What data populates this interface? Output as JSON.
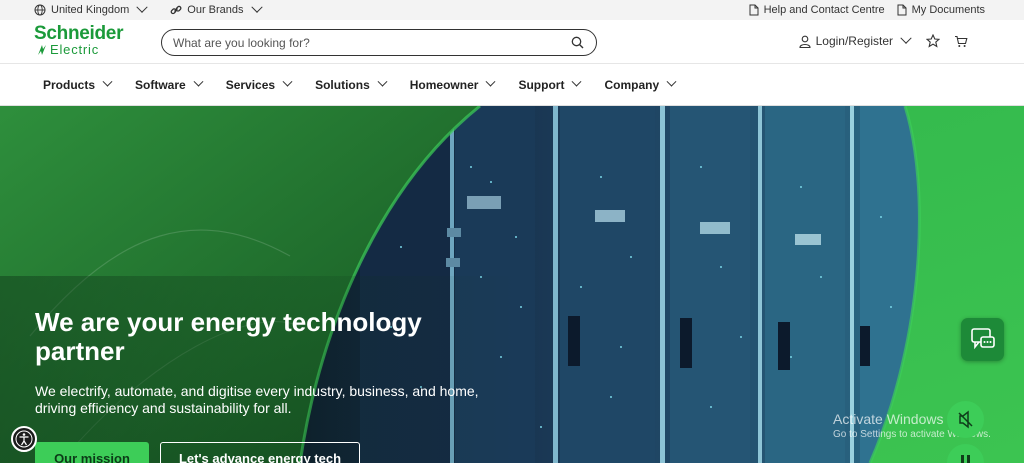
{
  "utility_bar": {
    "region": "United Kingdom",
    "brands": "Our Brands",
    "help": "Help and Contact Centre",
    "documents": "My Documents"
  },
  "header": {
    "logo_top": "Schneider",
    "logo_bottom": "Electric",
    "search_placeholder": "What are you looking for?",
    "login": "Login/Register"
  },
  "nav": {
    "items": [
      "Products",
      "Software",
      "Services",
      "Solutions",
      "Homeowner",
      "Support",
      "Company"
    ]
  },
  "hero": {
    "title": "We are your energy technology partner",
    "subtitle": "We electrify, automate, and digitise every industry, business, and home, driving efficiency and sustainability for all.",
    "primary_button": "Our mission",
    "secondary_button": "Let's advance energy tech"
  },
  "windows_watermark": {
    "title": "Activate Windows",
    "subtitle": "Go to Settings to activate Windows."
  },
  "colors": {
    "brand_green": "#3dcd58",
    "dark_green": "#1b9a3a"
  }
}
